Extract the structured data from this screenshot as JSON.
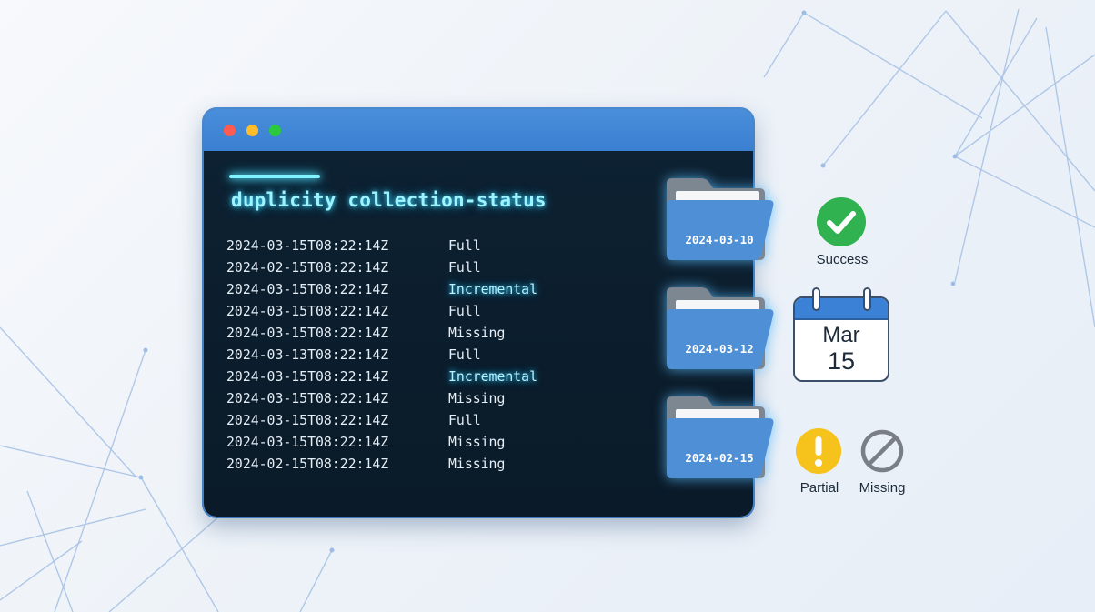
{
  "window": {
    "buttons": [
      "close",
      "minimize",
      "maximize"
    ]
  },
  "terminal": {
    "command": "duplicity collection-status",
    "rows": [
      {
        "timestamp": "2024-03-15T08:22:14Z",
        "type": "Full"
      },
      {
        "timestamp": "2024-02-15T08:22:14Z",
        "type": "Full"
      },
      {
        "timestamp": "2024-03-15T08:22:14Z",
        "type": "Incremental"
      },
      {
        "timestamp": "2024-03-15T08:22:14Z",
        "type": "Full"
      },
      {
        "timestamp": "2024-03-15T08:22:14Z",
        "type": "Missing"
      },
      {
        "timestamp": "2024-03-13T08:22:14Z",
        "type": "Full"
      },
      {
        "timestamp": "2024-03-15T08:22:14Z",
        "type": "Incremental"
      },
      {
        "timestamp": "2024-03-15T08:22:14Z",
        "type": "Missing"
      },
      {
        "timestamp": "2024-03-15T08:22:14Z",
        "type": "Full"
      },
      {
        "timestamp": "2024-03-15T08:22:14Z",
        "type": "Missing"
      },
      {
        "timestamp": "2024-02-15T08:22:14Z",
        "type": "Missing"
      }
    ]
  },
  "folders": [
    {
      "label": "2024-03-10",
      "icon": "folder-icon"
    },
    {
      "label": "2024-03-12",
      "icon": "folder-icon"
    },
    {
      "label": "2024-02-15",
      "icon": "folder-icon"
    }
  ],
  "status": {
    "success": {
      "label": "Success",
      "icon": "check-circle-icon",
      "color": "#2fb24f"
    },
    "partial": {
      "label": "Partial",
      "icon": "exclamation-circle-icon",
      "color": "#f6c21c"
    },
    "missing": {
      "label": "Missing",
      "icon": "prohibited-icon",
      "color": "#7a7f86"
    }
  },
  "calendar": {
    "month": "Mar",
    "day": "15",
    "icon": "calendar-icon"
  },
  "colors": {
    "titlebar": "#3a7fd1",
    "terminal_bg": "#0a1a28",
    "glow": "#7ff3ff",
    "folder": "#4f8fd6"
  }
}
